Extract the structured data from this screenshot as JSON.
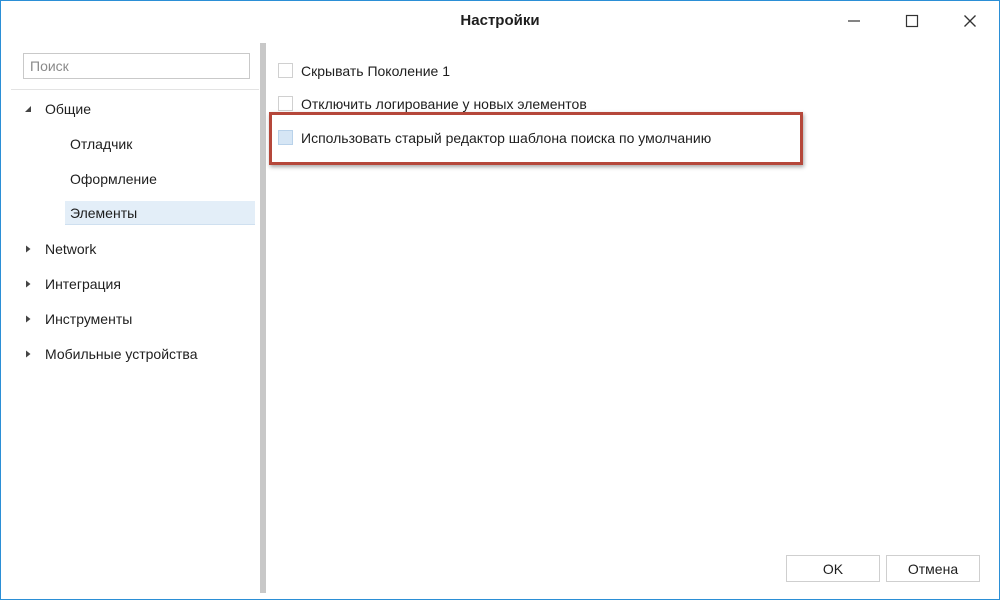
{
  "window": {
    "title": "Настройки",
    "accent_color": "#2b8fd6"
  },
  "sidebar": {
    "search_placeholder": "Поиск",
    "groups": [
      {
        "label": "Общие",
        "expanded": true,
        "children": [
          {
            "label": "Отладчик",
            "selected": false
          },
          {
            "label": "Оформление",
            "selected": false
          },
          {
            "label": "Элементы",
            "selected": true
          }
        ]
      },
      {
        "label": "Network",
        "expanded": false
      },
      {
        "label": "Интеграция",
        "expanded": false
      },
      {
        "label": "Инструменты",
        "expanded": false
      },
      {
        "label": "Мобильные устройства",
        "expanded": false
      }
    ]
  },
  "content": {
    "options": [
      {
        "label": "Скрывать Поколение 1",
        "checked": false
      },
      {
        "label": "Отключить логирование у новых элементов",
        "checked": false
      },
      {
        "label": "Использовать старый редактор шаблона поиска по умолчанию",
        "checked": false,
        "focused": true
      }
    ],
    "highlight_color": "#b5473a"
  },
  "footer": {
    "ok_label": "OK",
    "cancel_label": "Отмена"
  }
}
